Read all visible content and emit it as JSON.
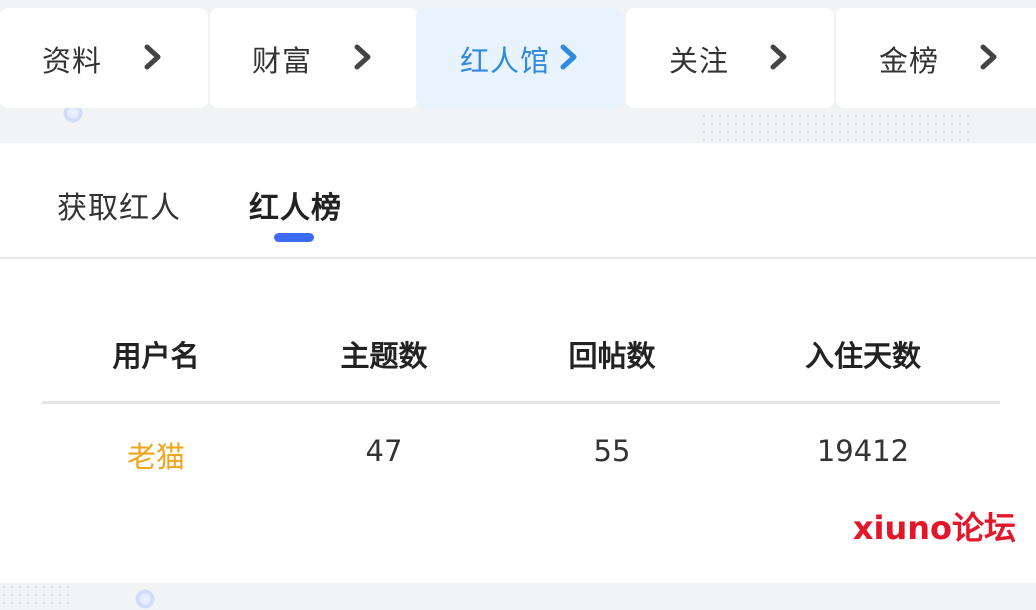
{
  "top_nav": {
    "tabs": [
      {
        "label": "资料",
        "active": false
      },
      {
        "label": "财富",
        "active": false
      },
      {
        "label": "红人馆",
        "active": true
      },
      {
        "label": "关注",
        "active": false
      },
      {
        "label": "金榜",
        "active": false
      }
    ],
    "active_color": "#2f8ae0",
    "active_bg": "#e8f3fd"
  },
  "sub_tabs": {
    "tabs": [
      {
        "label": "获取红人",
        "active": false
      },
      {
        "label": "红人榜",
        "active": true
      }
    ],
    "indicator_color": "#3b6cf3"
  },
  "table": {
    "headers": [
      "用户名",
      "主题数",
      "回帖数",
      "入住天数"
    ],
    "rows": [
      {
        "username": "老猫",
        "topics": "47",
        "replies": "55",
        "days": "19412"
      }
    ],
    "username_color": "#f0a51b"
  },
  "watermark": {
    "text": "xiuno论坛",
    "color": "#e3162a"
  }
}
